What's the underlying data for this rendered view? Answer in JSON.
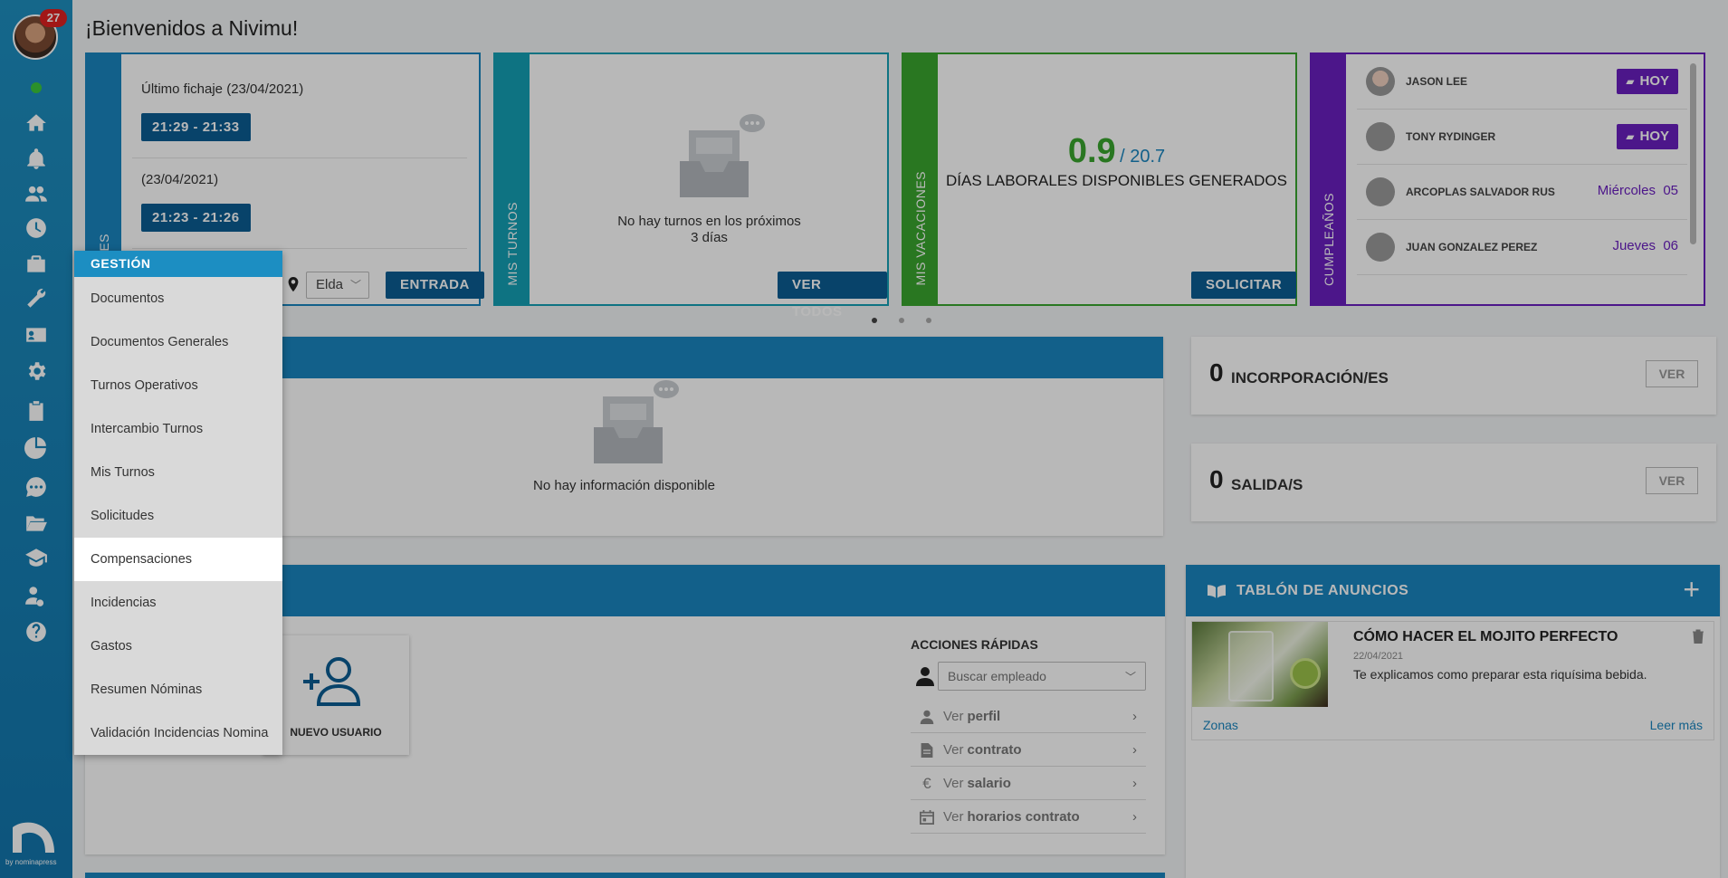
{
  "sidebar": {
    "notification_count": "27",
    "brand": "by nominapress",
    "icons": [
      "home-icon",
      "bell-icon",
      "users-icon",
      "clock-icon",
      "briefcase-icon",
      "tools-icon",
      "id-card-icon",
      "gear-icon",
      "clipboard-icon",
      "pie-chart-icon",
      "chat-icon",
      "folder-open-icon",
      "graduation-cap-icon",
      "user-money-icon",
      "help-icon"
    ]
  },
  "header": {
    "title": "¡Bienvenidos a Nivimu!"
  },
  "fichajes": {
    "strip_label": "CHAJES",
    "last_label": "Último fichaje (23/04/2021)",
    "last_range": "21:29 - 21:33",
    "prev_label": "(23/04/2021)",
    "prev_range": "21:23 - 21:26",
    "location": "Elda",
    "entrada_button": "ENTRADA"
  },
  "turnos": {
    "strip_label": "MIS TURNOS",
    "empty_line1": "No hay turnos en los próximos",
    "empty_line2": "3 días",
    "button": "VER TODOS"
  },
  "vacaciones": {
    "strip_label": "MIS VACACIONES",
    "available": "0.9",
    "total": "/ 20.7",
    "caption": "DÍAS LABORALES DISPONIBLES GENERADOS",
    "button": "SOLICITAR",
    "accent": "#3aa52e"
  },
  "cumpleanos": {
    "strip_label": "CUMPLEAÑOS",
    "accent": "#6a1fbf",
    "items": [
      {
        "name": "JASON LEE",
        "badge": "HOY",
        "day": "",
        "num": ""
      },
      {
        "name": "TONY RYDINGER",
        "badge": "HOY",
        "day": "",
        "num": ""
      },
      {
        "name": "ARCOPLAS SALVADOR RUS",
        "badge": "",
        "day": "Miércoles",
        "num": "05"
      },
      {
        "name": "JUAN GONZALEZ PEREZ",
        "badge": "",
        "day": "Jueves",
        "num": "06"
      }
    ]
  },
  "info_panel": {
    "empty": "No hay información disponible"
  },
  "incorporaciones": {
    "count": "0",
    "label": "INCORPORACIÓN/ES",
    "button": "VER"
  },
  "salidas": {
    "count": "0",
    "label": "SALIDA/S",
    "button": "VER"
  },
  "quick": {
    "new_user": "NUEVO USUARIO",
    "title": "ACCIONES RÁPIDAS",
    "search_placeholder": "Buscar empleado",
    "actions": [
      {
        "prefix": "Ver",
        "bold": "perfil"
      },
      {
        "prefix": "Ver",
        "bold": "contrato"
      },
      {
        "prefix": "Ver",
        "bold": "salario"
      },
      {
        "prefix": "Ver",
        "bold": "horarios contrato"
      }
    ]
  },
  "tablon": {
    "title": "TABLÓN DE ANUNCIOS",
    "post_title": "CÓMO HACER EL MOJITO PERFECTO",
    "post_date": "22/04/2021",
    "post_body": "Te explicamos como preparar esta riquísima bebida.",
    "zone_link": "Zonas",
    "more_link": "Leer más"
  },
  "menu": {
    "header": "GESTIÓN",
    "items": [
      "Documentos",
      "Documentos Generales",
      "Turnos Operativos",
      "Intercambio Turnos",
      "Mis Turnos",
      "Solicitudes",
      "Compensaciones",
      "Incidencias",
      "Gastos",
      "Resumen Nóminas",
      "Validación Incidencias Nomina"
    ],
    "active_index": 6
  }
}
